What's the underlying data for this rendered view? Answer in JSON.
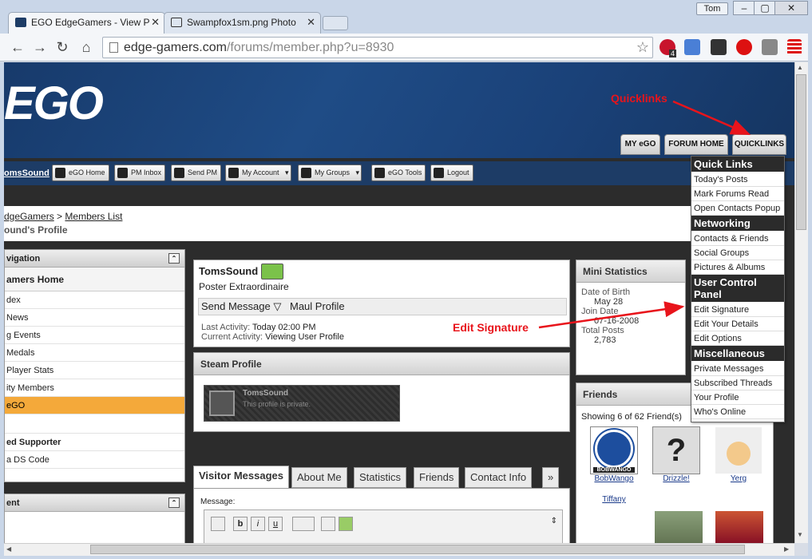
{
  "browser": {
    "tabs": [
      {
        "label": "EGO EdgeGamers - View P"
      },
      {
        "label": "Swampfox1sm.png Photo"
      }
    ],
    "user": "Tom",
    "url_host": "edge-gamers.com",
    "url_path": "/forums/member.php?u=8930",
    "ext_badge": "4"
  },
  "site": {
    "logo": "EGO",
    "nav_tabs": [
      "MY eGO",
      "FORUM HOME",
      "QUICKLINKS"
    ],
    "username_link": "omsSound",
    "subnav": [
      "eGO Home",
      "PM Inbox",
      "Send PM",
      "My Account",
      "My Groups",
      "eGO Tools",
      "Logout"
    ]
  },
  "breadcrumb": {
    "parts": [
      "dgeGamers",
      "Members List"
    ],
    "sep": ">",
    "title": "ound's Profile"
  },
  "sidebar": {
    "header": "vigation",
    "section": "amers Home",
    "items": [
      "dex",
      "News",
      "g Events",
      "Medals",
      "Player Stats",
      "ity Members",
      "eGO"
    ],
    "section2": "ed Supporter",
    "items2": [
      "a DS Code"
    ],
    "header2": "ent"
  },
  "profile": {
    "name": "TomsSound",
    "rank": "Poster Extraordinaire",
    "actions": [
      "Send Message",
      "Maul Profile"
    ],
    "last_activity_label": "Last Activity:",
    "last_activity": "Today 02:00 PM",
    "current_activity_label": "Current Activity:",
    "current_activity": "Viewing User Profile"
  },
  "steam": {
    "title": "Steam Profile",
    "name": "TomsSound",
    "status": "This profile is private."
  },
  "visitor_tabs": [
    "Visitor Messages",
    "About Me",
    "Statistics",
    "Friends",
    "Contact Info",
    "»"
  ],
  "message_label": "Message:",
  "ministats": {
    "title": "Mini Statistics",
    "dob_label": "Date of Birth",
    "dob": "May 28",
    "join_label": "Join Date",
    "join": "07-16-2008",
    "posts_label": "Total Posts",
    "posts": "2,783"
  },
  "friends": {
    "title": "Friends",
    "showing": "Showing 6 of 62 Friend(s)",
    "list": [
      "BobWango",
      "Drizzle!",
      "Yerg",
      "Tiffany"
    ],
    "vw_text": "BOBWANGO"
  },
  "quicklinks_menu": {
    "sections": [
      {
        "title": "Quick Links",
        "items": [
          "Today's Posts",
          "Mark Forums Read",
          "Open Contacts Popup"
        ]
      },
      {
        "title": "Networking",
        "items": [
          "Contacts & Friends",
          "Social Groups",
          "Pictures & Albums"
        ]
      },
      {
        "title": "User Control Panel",
        "items": [
          "Edit Signature",
          "Edit Your Details",
          "Edit Options"
        ]
      },
      {
        "title": "Miscellaneous",
        "items": [
          "Private Messages",
          "Subscribed Threads",
          "Your Profile",
          "Who's Online"
        ]
      }
    ]
  },
  "annotations": {
    "quicklinks": "Quicklinks",
    "edit_signature": "Edit Signature"
  },
  "colors": {
    "annotation": "#e8141b",
    "banner": "#1f4c86",
    "active_item": "#f4a93a"
  }
}
